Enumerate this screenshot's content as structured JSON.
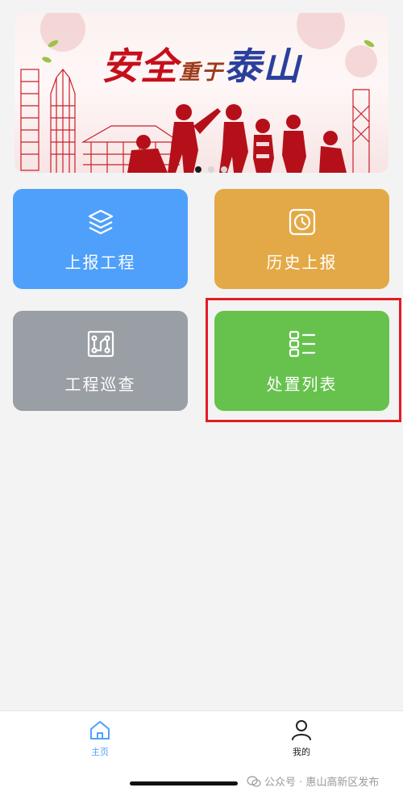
{
  "banner": {
    "title_part1": "安全",
    "title_part2": "重于",
    "title_part3": "泰山",
    "slide_count": 3,
    "active_slide": 1
  },
  "tiles": [
    {
      "label": "上报工程",
      "color": "#4fa0fb",
      "icon": "layers-icon"
    },
    {
      "label": "历史上报",
      "color": "#e4a947",
      "icon": "clock-icon"
    },
    {
      "label": "工程巡查",
      "color": "#9a9ea5",
      "icon": "route-icon"
    },
    {
      "label": "处置列表",
      "color": "#66c24d",
      "icon": "list-icon",
      "highlighted": true
    }
  ],
  "nav": [
    {
      "label": "主页",
      "icon": "home-icon",
      "active": true,
      "color": "#4fa0fb"
    },
    {
      "label": "我的",
      "icon": "user-icon",
      "active": false,
      "color": "#222222"
    }
  ],
  "watermark": {
    "text": "公众号 · 惠山高新区发布"
  },
  "colors": {
    "highlight": "#e21c24",
    "background": "#f3f3f3"
  }
}
